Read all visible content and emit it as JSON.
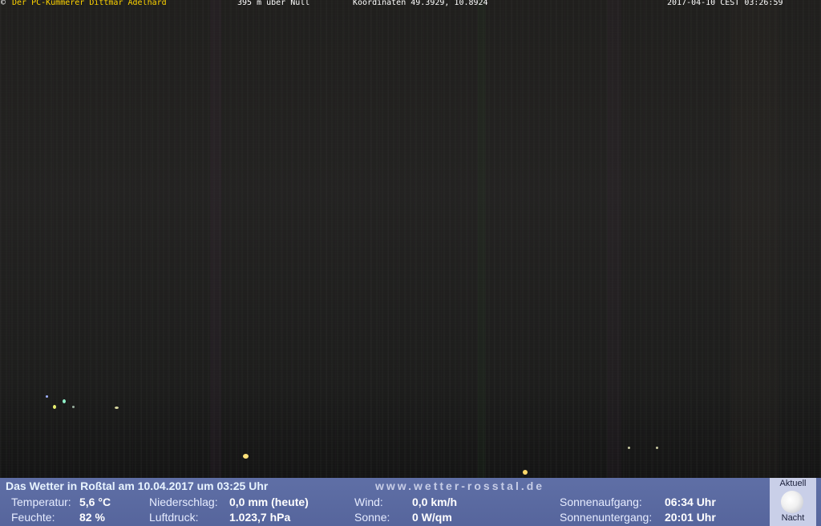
{
  "overlay": {
    "copyright_symbol": "©",
    "owner": "Der PC-Kümmerer Dittmar Adelhard",
    "altitude": "395 m über Null",
    "coordinates": "Koordinaten 49.3929, 10.8924",
    "timestamp": "2017-04-10 CEST 03:26:59"
  },
  "weather": {
    "headline": "Das Wetter in Roßtal am 10.04.2017 um 03:25 Uhr",
    "website": "www.wetter-rosstal.de",
    "temperature_label": "Temperatur:",
    "temperature_value": "5,6 °C",
    "humidity_label": "Feuchte:",
    "humidity_value": "82 %",
    "precip_label": "Niederschlag:",
    "precip_value": "0,0 mm (heute)",
    "pressure_label": "Luftdruck:",
    "pressure_value": "1.023,7 hPa",
    "wind_label": "Wind:",
    "wind_value": "0,0 km/h",
    "sun_label": "Sonne:",
    "sun_value": "0 W/qm",
    "sunrise_label": "Sonnenaufgang:",
    "sunrise_value": "06:34 Uhr",
    "sunset_label": "Sonnenuntergang:",
    "sunset_value": "20:01 Uhr"
  },
  "moon": {
    "top_label": "Aktuell",
    "bottom_label": "Nacht",
    "icon": "moon-icon"
  },
  "colors": {
    "owner_text": "#ffd400",
    "panel_bg": "#5a69a0",
    "moon_box_bg": "#c9cfe8"
  }
}
